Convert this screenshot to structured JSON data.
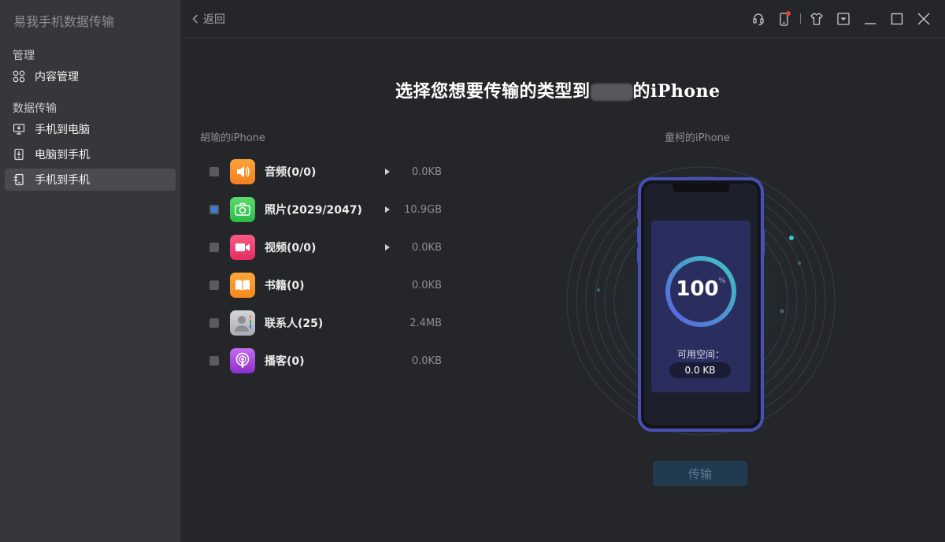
{
  "app": {
    "title": "易我手机数据传输"
  },
  "sidebar": {
    "section_manage": "管理",
    "section_transfer": "数据传输",
    "items": [
      {
        "label": "内容管理",
        "icon": "grid-icon"
      },
      {
        "label": "手机到电脑",
        "icon": "monitor-icon"
      },
      {
        "label": "电脑到手机",
        "icon": "phone-download-icon"
      },
      {
        "label": "手机到手机",
        "icon": "phone-transfer-icon",
        "active": true
      }
    ]
  },
  "topbar": {
    "back_label": "返回"
  },
  "main": {
    "heading_prefix": "选择您想要传输的类型到",
    "heading_suffix": "的iPhone",
    "source_device": "胡瑜的iPhone",
    "target_device": "童柯的iPhone",
    "items": [
      {
        "label": "音频(0/0)",
        "size": "0.0KB",
        "checked": false,
        "icon": "audio-icon",
        "color": "#f7932a",
        "has_arrow": true
      },
      {
        "label": "照片(2029/2047)",
        "size": "10.9GB",
        "checked": true,
        "icon": "camera-icon",
        "color": "#3cc554",
        "has_arrow": true
      },
      {
        "label": "视频(0/0)",
        "size": "0.0KB",
        "checked": false,
        "icon": "video-icon",
        "color": "#f04472",
        "has_arrow": true
      },
      {
        "label": "书籍(0)",
        "size": "0.0KB",
        "checked": false,
        "icon": "book-icon",
        "color": "#f7931d",
        "has_arrow": false
      },
      {
        "label": "联系人(25)",
        "size": "2.4MB",
        "checked": false,
        "icon": "contacts-icon",
        "color": "#b6b8bd",
        "has_arrow": false
      },
      {
        "label": "播客(0)",
        "size": "0.0KB",
        "checked": false,
        "icon": "podcast-icon",
        "color": "#a34ad8",
        "has_arrow": false
      }
    ],
    "progress": {
      "value": "100",
      "unit": "%",
      "fraction": 1.0
    },
    "space_label": "可用空间：",
    "space_value": "0.0 KB",
    "transfer_button": "传输"
  },
  "colors": {
    "accent": "#3b7bdc",
    "ring_start": "#5b5fe0",
    "ring_end": "#3ec8c4",
    "phone_frame": "#4a4fb6"
  }
}
